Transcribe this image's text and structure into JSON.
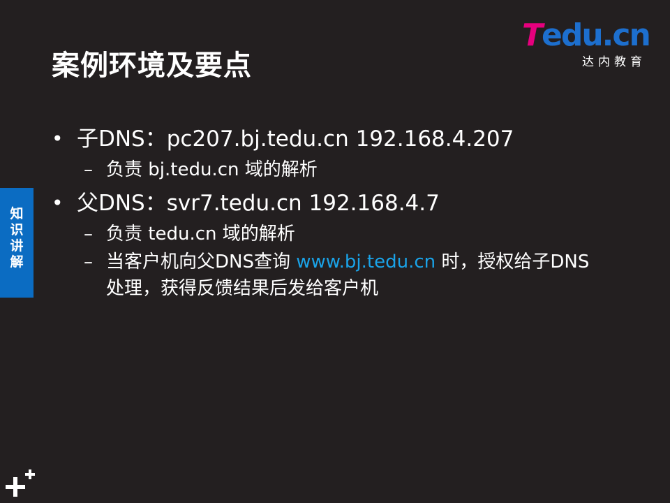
{
  "title": "案例环境及要点",
  "logo": {
    "brand_t": "T",
    "brand_rest": "edu.cn",
    "subtitle": "达内教育"
  },
  "side_tab": {
    "label": "知识讲解"
  },
  "bullets": [
    {
      "text": "子DNS：pc207.bj.tedu.cn 192.168.4.207",
      "subs": [
        {
          "text": "负责 bj.tedu.cn 域的解析"
        }
      ]
    },
    {
      "text": "父DNS：svr7.tedu.cn 192.168.4.7",
      "subs": [
        {
          "text": "负责 tedu.cn 域的解析"
        },
        {
          "prefix": "当客户机向父DNS查询 ",
          "link": "www.bj.tedu.cn",
          "suffix": " 时，授权给子DNS处理，获得反馈结果后发给客户机"
        }
      ]
    }
  ],
  "bullet_glyph": "•",
  "dash_glyph": "–",
  "colors": {
    "background": "#231f20",
    "accent_blue": "#0b6cc2",
    "link": "#1aa3e8",
    "brand_pink": "#e6007e"
  },
  "corner_icon": "plus-plus-icon"
}
